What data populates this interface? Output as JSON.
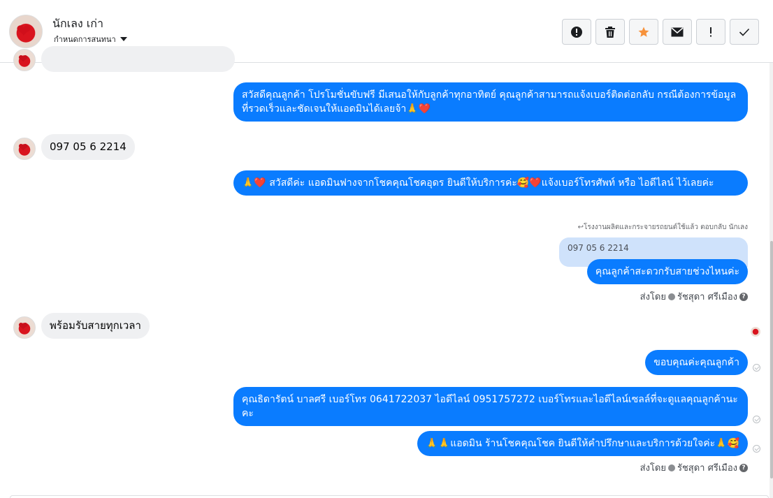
{
  "header": {
    "contact_name": "นักเลง เก่า",
    "assign_label": "กำหนดการสนทนา",
    "avatar_text": "ห่อสีโชค"
  },
  "toolbar": [
    {
      "name": "spam-button",
      "icon": "exclamation-circle-icon"
    },
    {
      "name": "delete-button",
      "icon": "trash-icon"
    },
    {
      "name": "star-button",
      "icon": "star-icon",
      "color": "#f7923b"
    },
    {
      "name": "mark-unread-button",
      "icon": "envelope-icon"
    },
    {
      "name": "follow-up-button",
      "icon": "exclamation-icon"
    },
    {
      "name": "done-button",
      "icon": "check-icon"
    }
  ],
  "messages": {
    "m1": "สวัสดีคุณลูกค้า โปรโมชั่นขับฟรี มีเสนอให้กับลูกค้าทุกอาทิตย์ คุณลูกค้าสามารถแจ้งเบอร์ติดต่อกลับ กรณีต้องการข้อมูลที่รวดเร็วและชัดเจนให้แอดมินได้เลยจ้า🙏❤️",
    "m2": "097 05 6 2214",
    "m3": "🙏❤️ สวัสดีค่ะ แอดมินฟางจากโชคคุณโชคอุดร ยินดีให้บริการค่ะ🥰❤️แจ้งเบอร์โทรศัพท์ หรือ ไอดีไลน์  ไว้เลยค่ะ",
    "reply_note": "โรงงานผลิตและกระจายรถยนต์ใช้แล้ว ตอบกลับ นักเลง",
    "quoted": "097 05 6 2214",
    "m4": "คุณลูกค้าสะดวกรับสายช่วงไหนค่ะ",
    "m5": "พร้อมรับสายทุกเวลา",
    "m6": "ขอบคุณค่ะคุณลูกค้า",
    "m7": "คุณธิดารัตน์ บาลศรี เบอร์โทร 0641722037  ไอดีไลน์ 0951757272   เบอร์โทรและไอดีไลน์เซลล์ที่จะดูแลคุณลูกค้านะคะ",
    "m8": "🙏🙏แอดมิน ร้านโชคคุณโชค ยินดีให้คำปรึกษาและบริการด้วยใจค่ะ🙏🥰",
    "sent_by_1": {
      "prefix": "ส่งโดย",
      "name": "รัชสุดา ศรีเมือง"
    },
    "sent_by_2": {
      "prefix": "ส่งโดย",
      "name": "รัชสุดา ศรีเมือง"
    }
  },
  "colors": {
    "outgoing_bubble": "#0a7cff",
    "incoming_bubble": "#eff0f2",
    "quoted_bubble": "#cfe2fb"
  }
}
